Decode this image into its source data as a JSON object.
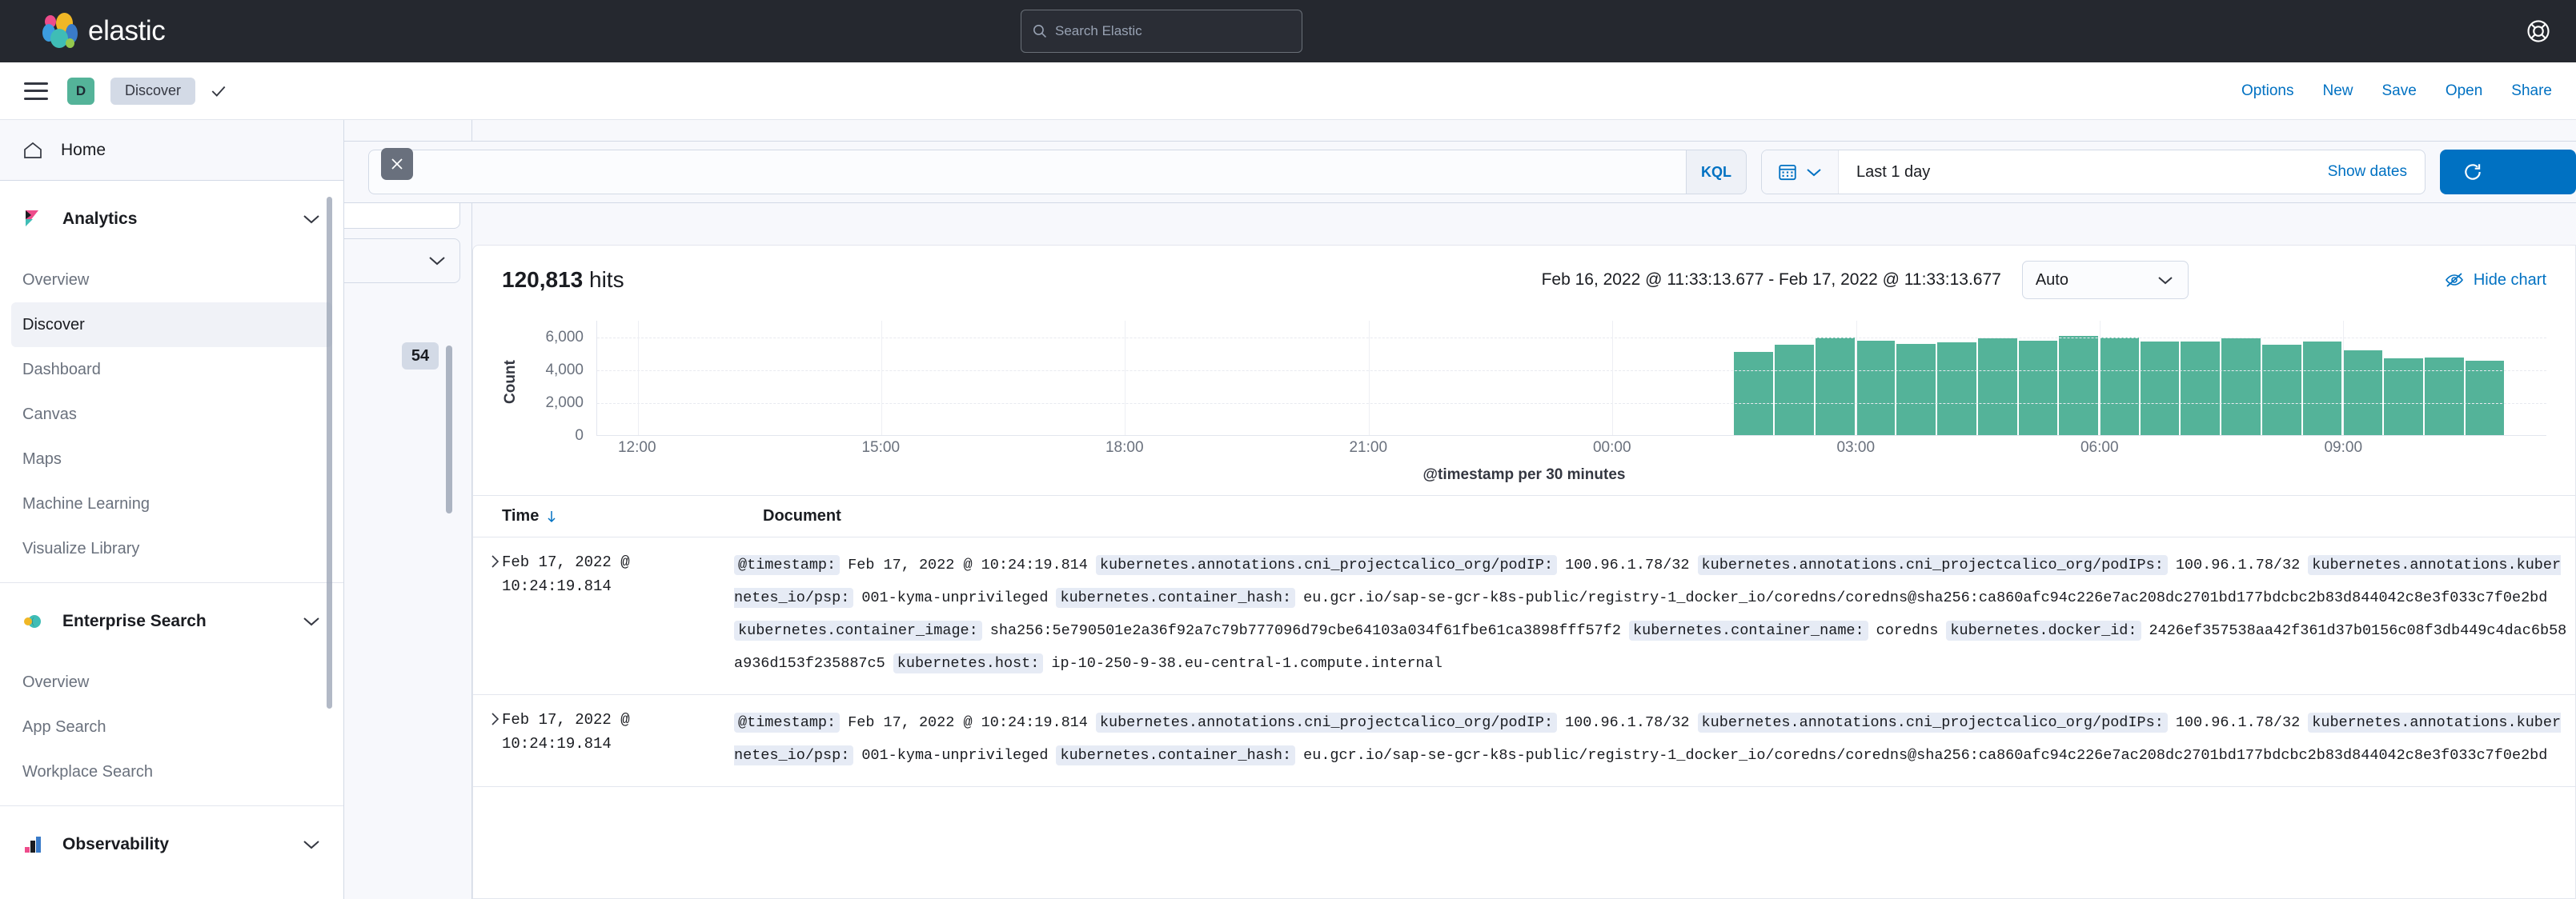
{
  "header": {
    "brand": "elastic",
    "brand_icon": "elastic-logo-icon",
    "search": {
      "placeholder": "Search Elastic",
      "icon": "search-icon",
      "value": ""
    },
    "help_icon": "help-lifebuoy-icon"
  },
  "navbar": {
    "menu_icon": "hamburger-menu-icon",
    "space_initial": "D",
    "breadcrumb": "Discover",
    "check_icon": "check-icon",
    "actions": [
      "Options",
      "New",
      "Save",
      "Open",
      "Share"
    ]
  },
  "sidebar": {
    "home_label": "Home",
    "home_icon": "home-icon",
    "sections": [
      {
        "title": "Analytics",
        "icon": "kibana-icon",
        "chevron": "chevron-down-icon",
        "items": [
          "Overview",
          "Discover",
          "Dashboard",
          "Canvas",
          "Maps",
          "Machine Learning",
          "Visualize Library"
        ],
        "active": "Discover"
      },
      {
        "title": "Enterprise Search",
        "icon": "enterprise-search-icon",
        "chevron": "chevron-down-icon",
        "items": [
          "Overview",
          "App Search",
          "Workplace Search"
        ],
        "active": ""
      },
      {
        "title": "Observability",
        "icon": "observability-icon",
        "chevron": "chevron-down-icon",
        "items": [],
        "active": ""
      }
    ]
  },
  "fieldbar": {
    "grid_icon": "grid-columns-icon",
    "collapse_icon": "collapse-left-icon",
    "search_placeholder": "",
    "field_count_badge": "54"
  },
  "query": {
    "close_icon": "close-icon",
    "input_value": "",
    "language_badge": "KQL",
    "calendar_icon": "calendar-icon",
    "calendar_chevron": "chevron-down-icon",
    "date_value": "Last 1 day",
    "show_dates": "Show dates",
    "refresh_icon": "refresh-icon",
    "refresh_label": ""
  },
  "main": {
    "hits_count": "120,813",
    "hits_label": "hits",
    "time_range": "Feb 16, 2022 @ 11:33:13.677 - Feb 17, 2022 @ 11:33:13.677",
    "interval": "Auto",
    "interval_chevron": "chevron-down-icon",
    "hide_chart_label": "Hide chart",
    "hide_chart_icon": "eye-slash-icon"
  },
  "chart_data": {
    "type": "bar",
    "title": "",
    "xlabel": "@timestamp per 30 minutes",
    "ylabel": "Count",
    "ylim": [
      0,
      7000
    ],
    "yticks": [
      0,
      2000,
      4000,
      6000
    ],
    "ytick_labels": [
      "0",
      "2,000",
      "4,000",
      "6,000"
    ],
    "xtick_labels": [
      "12:00",
      "15:00",
      "18:00",
      "21:00",
      "00:00",
      "03:00",
      "06:00",
      "09:00"
    ],
    "xtick_positions": [
      12.0,
      15.0,
      18.0,
      21.0,
      24.0,
      27.0,
      30.0,
      33.0
    ],
    "x_start_hour": 11.5,
    "x_end_hour": 35.5,
    "grid": true,
    "bar_color": "#54B399",
    "categories": [
      "01:30",
      "02:00",
      "02:30",
      "03:00",
      "03:30",
      "04:00",
      "04:30",
      "05:00",
      "05:30",
      "06:00",
      "06:30",
      "07:00",
      "07:30",
      "08:00",
      "08:30",
      "09:00",
      "09:30",
      "10:00",
      "10:30"
    ],
    "values": [
      5050,
      5500,
      5950,
      5750,
      5550,
      5650,
      5900,
      5750,
      6050,
      5950,
      5700,
      5700,
      5900,
      5500,
      5700,
      5150,
      4650,
      4700,
      4500
    ],
    "bar_start_hour": 25.5
  },
  "table": {
    "columns": [
      "Time",
      "Document"
    ],
    "sort_icon": "sort-descending-icon",
    "expand_icon": "chevron-right-icon",
    "rows": [
      {
        "time": "Feb 17, 2022 @ 10:24:19.814",
        "fields": [
          {
            "name": "@timestamp:",
            "value": "Feb 17, 2022 @ 10:24:19.814"
          },
          {
            "name": "kubernetes.annotations.cni_projectcalico_org/podIP:",
            "value": "100.96.1.78/32"
          },
          {
            "name": "kubernetes.annotations.cni_projectcalico_org/podIPs:",
            "value": "100.96.1.78/32"
          },
          {
            "name": "kubernetes.annotations.kubernetes_io/psp:",
            "value": "001-kyma-unprivileged"
          },
          {
            "name": "kubernetes.container_hash:",
            "value": "eu.gcr.io/sap-se-gcr-k8s-public/registry-1_docker_io/coredns/coredns@sha256:ca860afc94c226e7ac208dc2701bd177bdcbc2b83d844042c8e3f033c7f0e2bd"
          },
          {
            "name": "kubernetes.container_image:",
            "value": "sha256:5e790501e2a36f92a7c79b777096d79cbe64103a034f61fbe61ca3898fff57f2"
          },
          {
            "name": "kubernetes.container_name:",
            "value": "coredns"
          },
          {
            "name": "kubernetes.docker_id:",
            "value": "2426ef357538aa42f361d37b0156c08f3db449c4dac6b58a936d153f235887c5"
          },
          {
            "name": "kubernetes.host:",
            "value": "ip-10-250-9-38.eu-central-1.compute.internal"
          }
        ]
      },
      {
        "time": "Feb 17, 2022 @ 10:24:19.814",
        "fields": [
          {
            "name": "@timestamp:",
            "value": "Feb 17, 2022 @ 10:24:19.814"
          },
          {
            "name": "kubernetes.annotations.cni_projectcalico_org/podIP:",
            "value": "100.96.1.78/32"
          },
          {
            "name": "kubernetes.annotations.cni_projectcalico_org/podIPs:",
            "value": "100.96.1.78/32"
          },
          {
            "name": "kubernetes.annotations.kubernetes_io/psp:",
            "value": "001-kyma-unprivileged"
          },
          {
            "name": "kubernetes.container_hash:",
            "value": "eu.gcr.io/sap-se-gcr-k8s-public/registry-1_docker_io/coredns/coredns@sha256:ca860afc94c226e7ac208dc2701bd177bdcbc2b83d844042c8e3f033c7f0e2bd"
          }
        ]
      }
    ]
  }
}
